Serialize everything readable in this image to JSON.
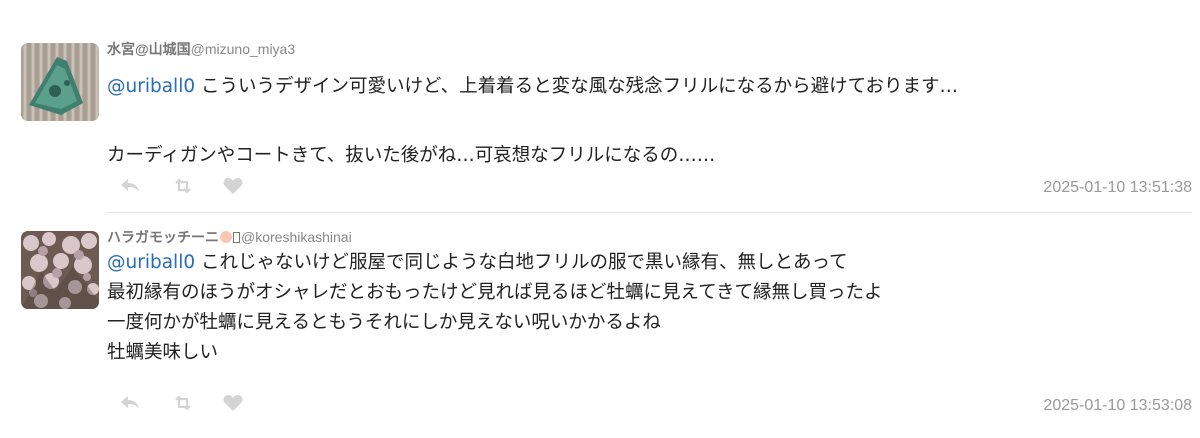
{
  "tweets": [
    {
      "display_name": "水宮@山城国",
      "screen_name": "@mizuno_miya3",
      "avatar_icon": "avatar-green-cloth-image",
      "mention": "@uriball0",
      "lines": [
        "こういうデザイン可愛いけど、上着着ると変な風な残念フリルになるから避けております…",
        "",
        "カーディガンやコートきて、抜いた後がね…可哀想なフリルになるの……"
      ],
      "timestamp": "2025-01-10 13:51:38",
      "actions": [
        "reply-icon",
        "retweet-icon",
        "heart-icon"
      ]
    },
    {
      "display_name": "ハラガモッチーニ",
      "screen_name": "@koreshikashinai",
      "avatar_icon": "avatar-cherry-blossom-image",
      "mention": "@uriball0",
      "lines": [
        "これじゃないけど服屋で同じような白地フリルの服で黒い縁有、無しとあって",
        "最初縁有のほうがオシャレだとおもったけど見れば見るほど牡蠣に見えてきて縁無し買ったよ",
        "一度何かが牡蠣に見えるともうそれにしか見えない呪いかかるよね",
        "牡蠣美味しい"
      ],
      "timestamp": "2025-01-10 13:53:08",
      "actions": [
        "reply-icon",
        "retweet-icon",
        "heart-icon"
      ]
    }
  ],
  "colors": {
    "mention": "#2a6db8",
    "meta": "#888888",
    "action_icon": "#d4d4d4",
    "divider": "#e6e6e6"
  }
}
